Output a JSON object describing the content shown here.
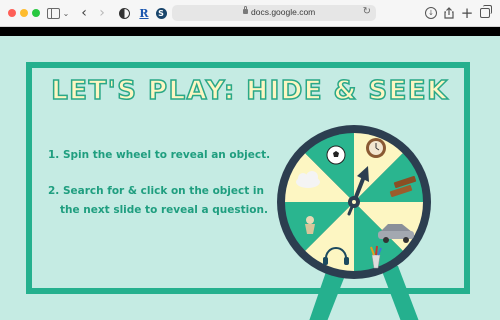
{
  "browser": {
    "url": "docs.google.com",
    "extension_letters": {
      "r": "R",
      "s": "S"
    }
  },
  "slide": {
    "title": "Let's Play: Hide & Seek",
    "instructions": {
      "step1": "1. Spin the wheel to reveal an object.",
      "step2_line1": "2. Search for & click on the object in",
      "step2_line2": "the next slide to reveal a question."
    }
  },
  "wheel": {
    "segments": [
      "soccer-ball",
      "clock",
      "wooden-blocks",
      "car",
      "pencil-cup",
      "headphones",
      "figurine",
      "cloud"
    ]
  },
  "colors": {
    "slide_bg": "#c5ebe3",
    "accent_green": "#25b08e",
    "cream": "#fdf6c2",
    "wheel_dark": "#2c3e50"
  }
}
